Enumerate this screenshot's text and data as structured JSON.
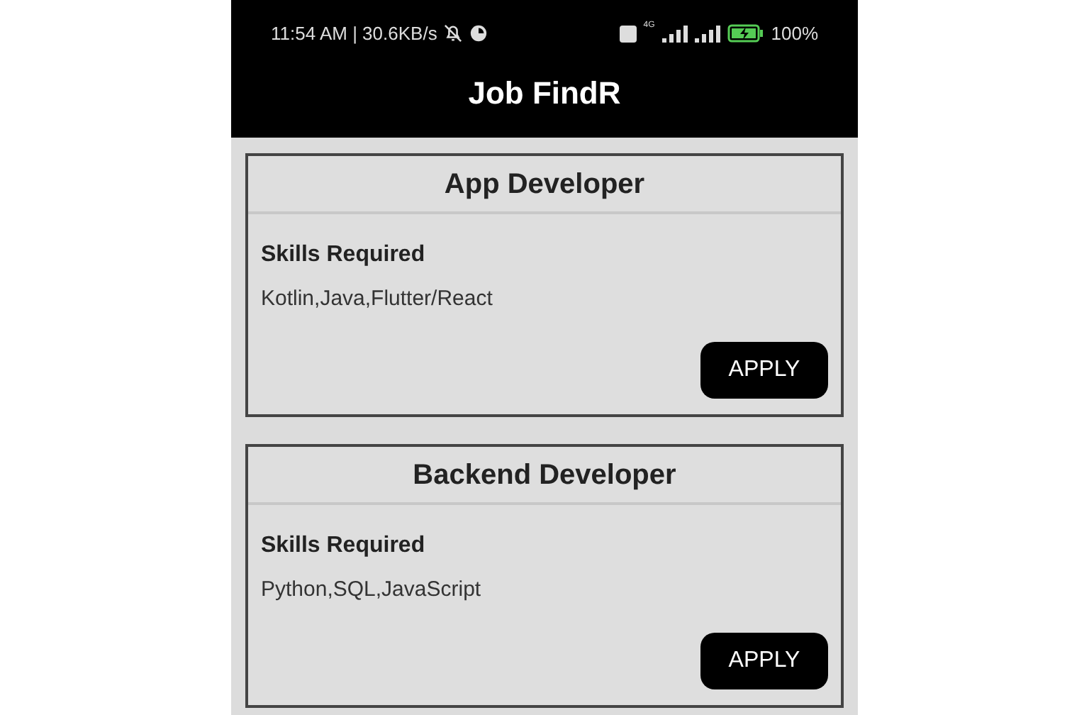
{
  "status_bar": {
    "time": "11:54 AM | 30.6KB/s",
    "network_label": "4G",
    "battery": "100%"
  },
  "app_bar": {
    "title": "Job FindR"
  },
  "jobs": [
    {
      "title": "App Developer",
      "skills_label": "Skills Required",
      "skills": "Kotlin,Java,Flutter/React",
      "button": "APPLY"
    },
    {
      "title": "Backend Developer",
      "skills_label": "Skills Required",
      "skills": "Python,SQL,JavaScript",
      "button": "APPLY"
    }
  ]
}
